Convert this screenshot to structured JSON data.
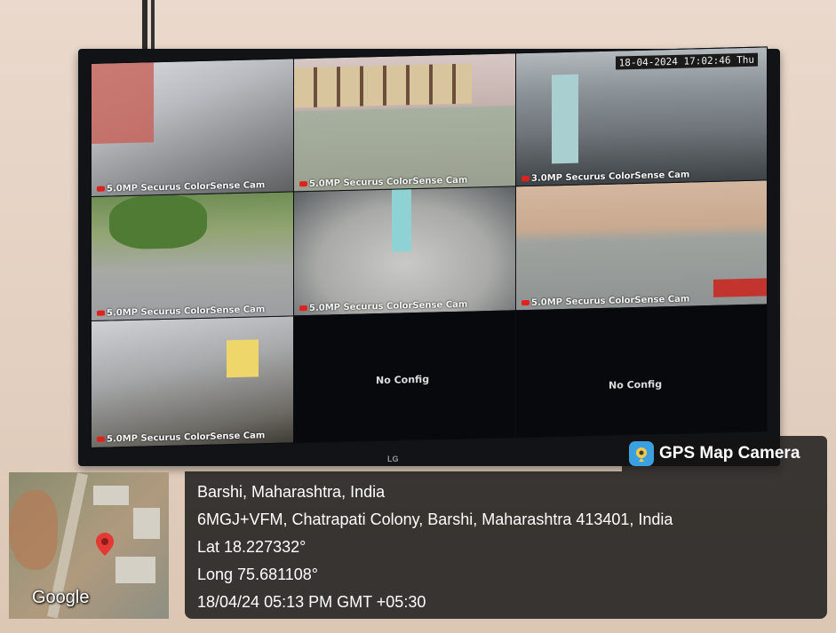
{
  "cameras": {
    "timestamp": "18-04-2024 17:02:46 Thu",
    "tiles": [
      {
        "label": "5.0MP Securus ColorSense Cam"
      },
      {
        "label": "5.0MP Securus ColorSense Cam"
      },
      {
        "label": "3.0MP Securus ColorSense Cam"
      },
      {
        "label": "5.0MP Securus ColorSense Cam"
      },
      {
        "label": "5.0MP Securus ColorSense Cam"
      },
      {
        "label": "5.0MP Securus ColorSense Cam"
      },
      {
        "label": "5.0MP Securus ColorSense Cam"
      }
    ],
    "empty": [
      {
        "text": "No Config"
      },
      {
        "text": "No Config"
      }
    ]
  },
  "tv": {
    "brand": "LG"
  },
  "overlay": {
    "brand": "GPS Map Camera",
    "city": "Barshi, Maharashtra, India",
    "address": "6MGJ+VFM, Chatrapati Colony, Barshi, Maharashtra 413401, India",
    "lat": "Lat 18.227332°",
    "long": "Long 75.681108°",
    "datetime": "18/04/24 05:13 PM GMT +05:30",
    "map_logo": "Google"
  },
  "icons": {
    "pin": "map-pin-icon",
    "app": "gps-camera-app-icon"
  },
  "colors": {
    "pin": "#e53935",
    "overlay_bg": "#141414",
    "rec": "#e0221f"
  }
}
